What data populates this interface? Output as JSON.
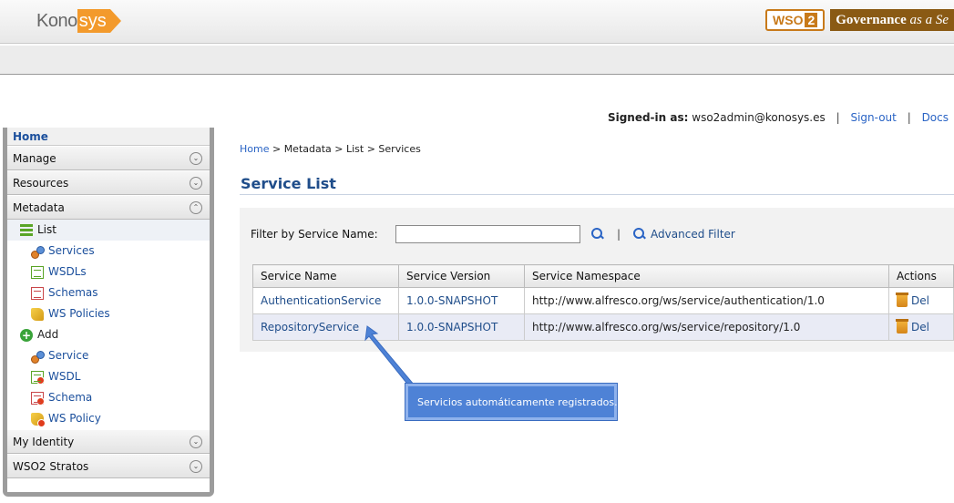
{
  "header": {
    "logo_prefix": "Kono",
    "logo_suffix": "sys",
    "brand_badge": "WSO",
    "brand_badge_sub": "2",
    "brand_text_bold": "Governance",
    "brand_text_italic": "as a Se"
  },
  "signin": {
    "label": "Signed-in as:",
    "user": "wso2admin@konosys.es",
    "sep": "|",
    "signout": "Sign-out",
    "docs": "Docs"
  },
  "sidebar": {
    "home": "Home",
    "manage": "Manage",
    "resources": "Resources",
    "metadata": "Metadata",
    "list_header": "List",
    "list_items": [
      "Services",
      "WSDLs",
      "Schemas",
      "WS Policies"
    ],
    "add_header": "Add",
    "add_items": [
      "Service",
      "WSDL",
      "Schema",
      "WS Policy"
    ],
    "my_identity": "My Identity",
    "stratos": "WSO2 Stratos",
    "chevron_down": "⌄",
    "chevron_up": "⌃"
  },
  "breadcrumb": {
    "home": "Home",
    "trail": " > Metadata > List > Services"
  },
  "page_title": "Service List",
  "filter": {
    "label": "Filter by Service Name:",
    "value": "",
    "sep": "|",
    "advanced": "Advanced Filter"
  },
  "table": {
    "headers": [
      "Service Name",
      "Service Version",
      "Service Namespace",
      "Actions"
    ],
    "rows": [
      {
        "name": "AuthenticationService",
        "version": "1.0.0-SNAPSHOT",
        "namespace": "http://www.alfresco.org/ws/service/authentication/1.0",
        "action": "Del"
      },
      {
        "name": "RepositoryService",
        "version": "1.0.0-SNAPSHOT",
        "namespace": "http://www.alfresco.org/ws/service/repository/1.0",
        "action": "Del"
      }
    ]
  },
  "callout": {
    "text": "Servicios automáticamente registrados."
  },
  "colors": {
    "link": "#1f4d8a",
    "accent": "#f39a2c",
    "callout": "#4e82d6"
  }
}
